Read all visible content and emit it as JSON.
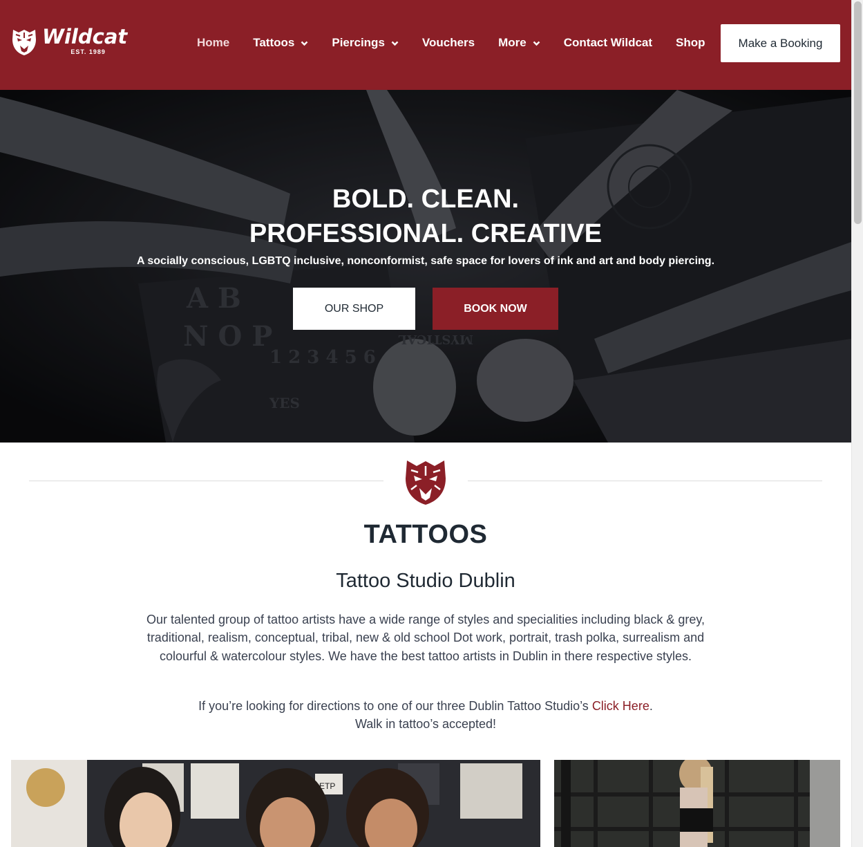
{
  "header": {
    "logo": {
      "wordmark": "Wildcat",
      "est": "EST. 1989"
    },
    "nav": [
      {
        "label": "Home"
      },
      {
        "label": "Tattoos"
      },
      {
        "label": "Piercings"
      },
      {
        "label": "Vouchers"
      },
      {
        "label": "More"
      },
      {
        "label": "Contact Wildcat"
      },
      {
        "label": "Shop"
      }
    ],
    "booking_button": "Make a Booking"
  },
  "hero": {
    "title_line1": "BOLD. CLEAN.",
    "title_line2": "PROFESSIONAL. CREATIVE",
    "subtitle": "A socially conscious, LGBTQ inclusive, nonconformist, safe space for lovers of ink and art and body piercing.",
    "shop_button": "OUR SHOP",
    "book_button": "BOOK NOW",
    "board_text": [
      "A B",
      "N O P",
      "1 2 3 4 5 6",
      "YES",
      "MYSTICAL"
    ]
  },
  "tattoos": {
    "title": "TATTOOS",
    "subtitle": "Tattoo Studio Dublin",
    "description": "Our talented group of tattoo artists have a wide range of styles and specialities including black & grey, traditional, realism, conceptual, tribal, new & old school Dot work, portrait, trash polka, surrealism and colourful & watercolour styles. We have the best tattoo artists in Dublin in there respective styles.",
    "directions_before": "If you’re looking for directions to one of our three Dublin Tattoo Studio’s ",
    "directions_link": "Click Here",
    "directions_after": ".",
    "walk_in": "Walk in tattoo’s accepted!",
    "photo_sign": "ETP"
  },
  "colors": {
    "brand": "#8b1f27",
    "text": "#1f2933"
  }
}
